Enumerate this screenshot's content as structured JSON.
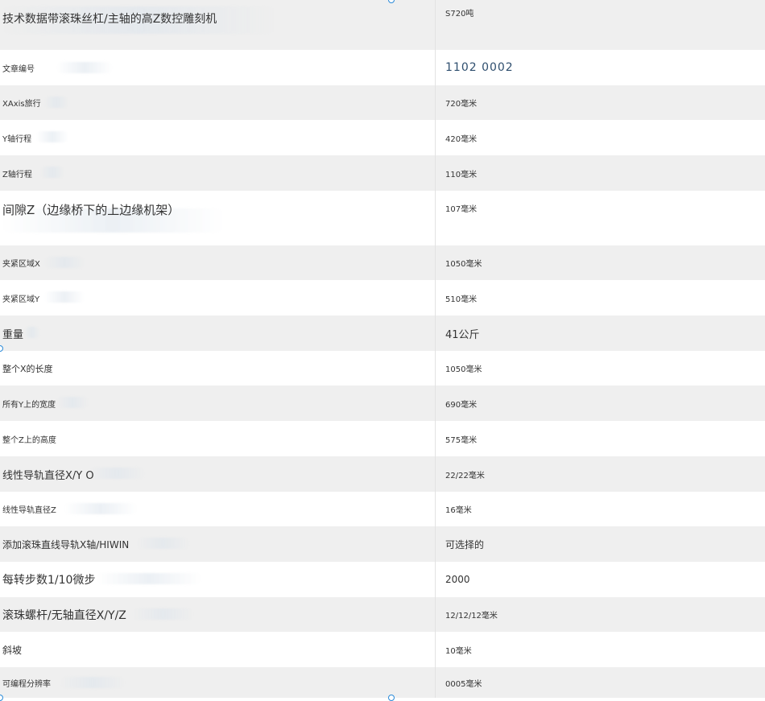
{
  "spec_table": {
    "rows": [
      {
        "label": "技术数据带滚珠丝杠/主轴的高Z数控雕刻机",
        "value": "S720吨"
      },
      {
        "label": "文章编号",
        "value": "1102 0002"
      },
      {
        "label": "XAxis旅行",
        "value": "720毫米"
      },
      {
        "label": "Y轴行程",
        "value": "420毫米"
      },
      {
        "label": "Z轴行程",
        "value": "110毫米"
      },
      {
        "label": "间隙Z（边缘桥下的上边缘机架）",
        "value": "107毫米"
      },
      {
        "label": "夹紧区域X",
        "value": "1050毫米"
      },
      {
        "label": "夹紧区域Y",
        "value": "510毫米"
      },
      {
        "label": "重量",
        "value": "41公斤"
      },
      {
        "label": "整个X的长度",
        "value": "1050毫米"
      },
      {
        "label": "所有Y上的宽度",
        "value": "690毫米"
      },
      {
        "label": "整个Z上的高度",
        "value": "575毫米"
      },
      {
        "label": "线性导轨直径X/Y O",
        "value": "22/22毫米"
      },
      {
        "label": "线性导轨直径Z",
        "value": "16毫米"
      },
      {
        "label": "添加滚珠直线导轨X轴/HIWIN",
        "value": "可选择的"
      },
      {
        "label": "每转步数1/10微步",
        "value": "2000"
      },
      {
        "label": "滚珠螺杆/无轴直径X/Y/Z",
        "value": "12/12/12毫米"
      },
      {
        "label": "斜坡",
        "value": "10毫米"
      },
      {
        "label": "可编程分辨率",
        "value": "0005毫米"
      }
    ]
  }
}
